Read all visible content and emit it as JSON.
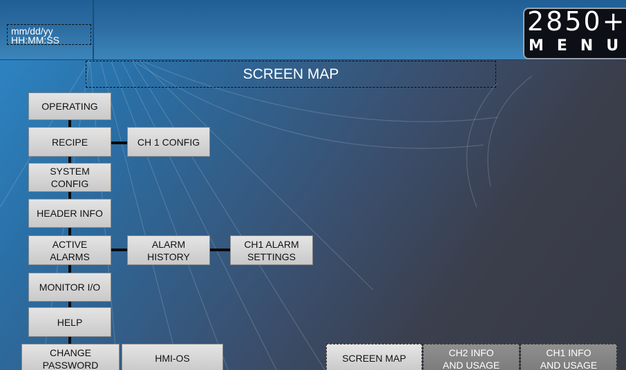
{
  "header": {
    "date_format": "mm/dd/yy",
    "time_format": "HH:MM:SS",
    "logo_number": "2850+",
    "logo_menu": "MENU"
  },
  "screen_title": "SCREEN MAP",
  "menu_buttons": {
    "operating": "OPERATING",
    "recipe": "RECIPE",
    "ch1_config": "CH 1 CONFIG",
    "system_config": [
      "SYSTEM",
      "CONFIG"
    ],
    "header_info": "HEADER INFO",
    "active_alarms": [
      "ACTIVE",
      "ALARMS"
    ],
    "alarm_history": [
      "ALARM",
      "HISTORY"
    ],
    "ch1_alarm_settings": [
      "CH1 ALARM",
      "SETTINGS"
    ],
    "monitor_io": "MONITOR I/O",
    "help": "HELP",
    "change_password": [
      "CHANGE",
      "PASSWORD"
    ],
    "hmi_os": "HMI-OS"
  },
  "tabs": {
    "screen_map": "SCREEN MAP",
    "ch2_info": [
      "CH2 INFO",
      "AND USAGE"
    ],
    "ch1_info": [
      "CH1 INFO",
      "AND USAGE"
    ]
  },
  "colors": {
    "header": "#2c6ca1",
    "background_start": "#2d89c9",
    "background_end": "#363a45",
    "button": "#d6d6d6",
    "button_dark": "#858585"
  }
}
